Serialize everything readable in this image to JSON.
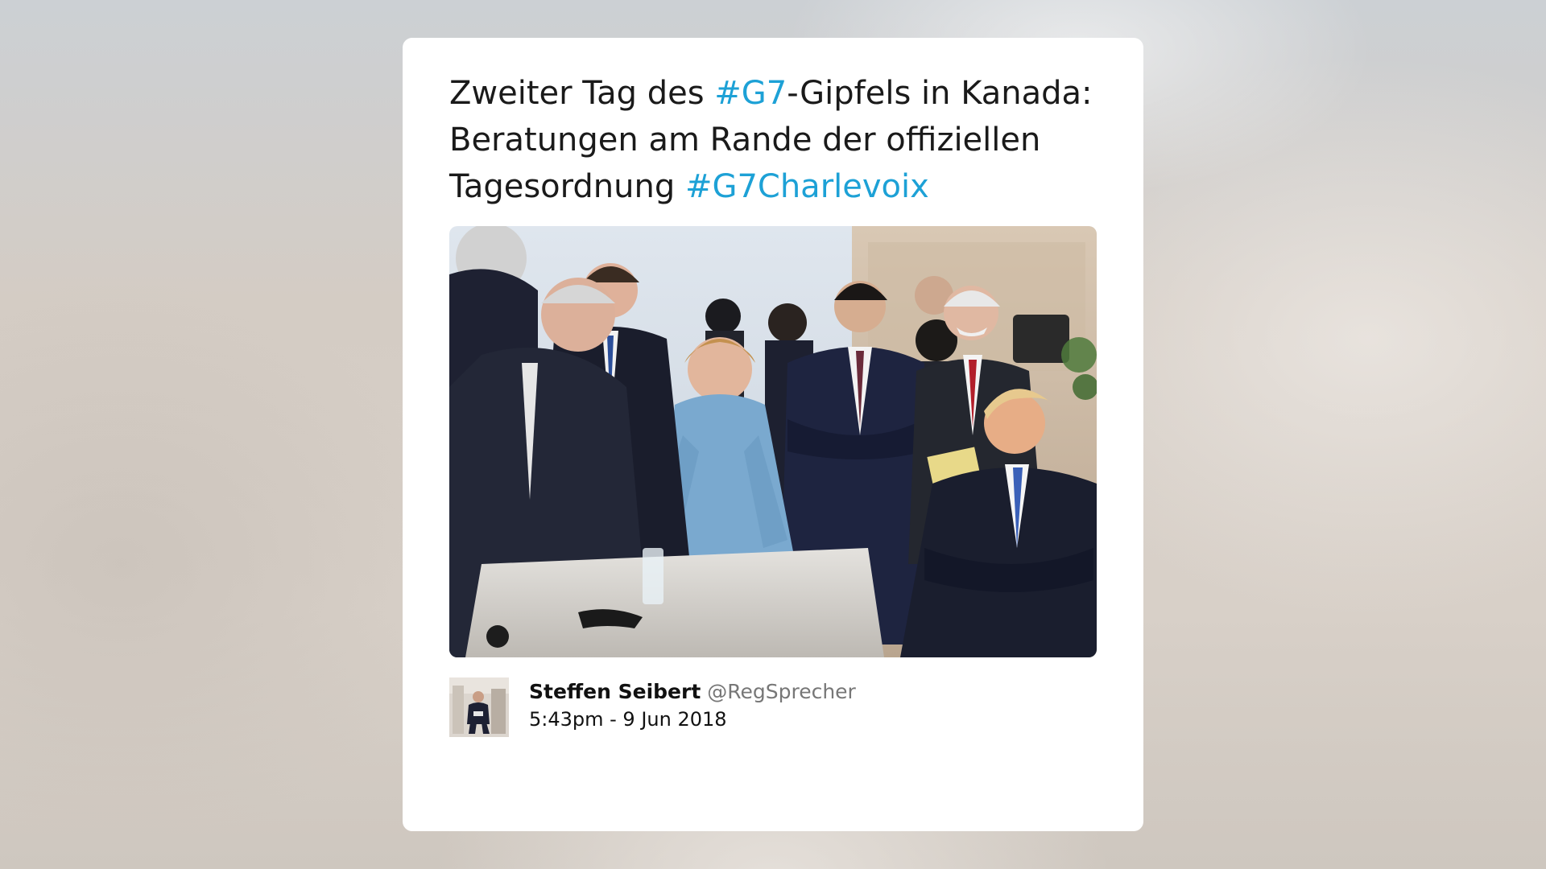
{
  "tweet": {
    "text_part1": "Zweiter Tag des ",
    "hashtag_g7": "#G7",
    "text_part2": "-Gipfels in Kanada: Beratungen am Rande der offiziellen Tagesordnung ",
    "hashtag_charlevoix": "#G7Charlevoix"
  },
  "author": {
    "name": "Steffen Seibert",
    "handle": "@RegSprecher"
  },
  "timestamp": "5:43pm - 9 Jun 2018",
  "colors": {
    "hashtag": "#1da1d6",
    "card_background": "#ffffff",
    "text": "#1a1a1a",
    "handle": "#777777"
  },
  "media": {
    "type": "photo",
    "icon": "photo-image"
  }
}
